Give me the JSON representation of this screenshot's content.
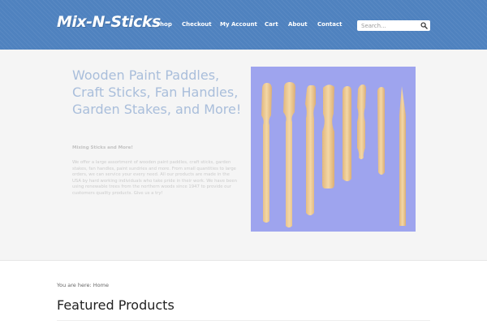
{
  "header": {
    "logo_text": "Mix-N-Sticks",
    "nav": [
      {
        "label": "Shop"
      },
      {
        "label": "Checkout"
      },
      {
        "label": "My Account"
      },
      {
        "label": "Cart"
      },
      {
        "label": "About"
      },
      {
        "label": "Contact"
      }
    ],
    "search": {
      "placeholder": "Search..."
    }
  },
  "hero": {
    "title": "Wooden Paint Paddles, Craft Sticks, Fan Handles, Garden Stakes, and More!",
    "subtitle": "Mixing Sticks and More!",
    "body": "We offer a large assortment of wooden paint paddles, craft sticks, garden stakes, fan handles, paint sundries and more.  From small quantities to large orders, we can service your every need.  All our products are made in the USA by hard working individuals who take pride in their work.  We have been using renewable trees from the northern woods since 1947 to provide our customers quality products.  Give us a try!",
    "image_alt": "wooden sticks"
  },
  "breadcrumb": {
    "text": "You are here: Home"
  },
  "featured": {
    "title": "Featured Products"
  },
  "colors": {
    "header_bg": "#4f82bf",
    "hero_bg": "#f5f5f5",
    "title_color": "#a9bedb",
    "image_bg": "#9ea4ee",
    "wood": "#ebc994"
  }
}
